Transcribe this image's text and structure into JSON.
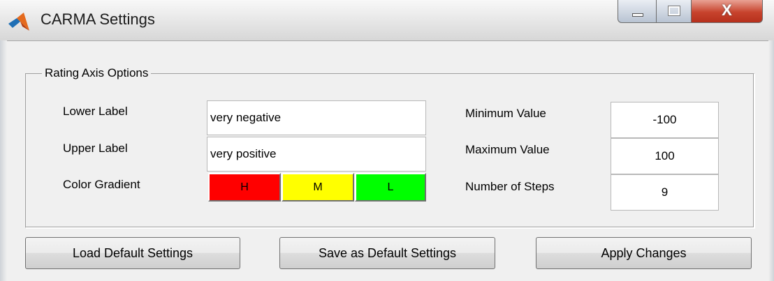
{
  "window": {
    "title": "CARMA Settings",
    "controls": {
      "minimize": "minimize",
      "maximize": "maximize",
      "close_label": "X"
    }
  },
  "group": {
    "title": "Rating Axis Options",
    "lower_label": {
      "label": "Lower Label",
      "value": "very negative"
    },
    "upper_label": {
      "label": "Upper Label",
      "value": "very positive"
    },
    "color_gradient": {
      "label": "Color Gradient",
      "swatches": [
        {
          "text": "H",
          "color": "#ff0000"
        },
        {
          "text": "M",
          "color": "#ffff00"
        },
        {
          "text": "L",
          "color": "#00ff00"
        }
      ]
    },
    "minimum_value": {
      "label": "Minimum Value",
      "value": "-100"
    },
    "maximum_value": {
      "label": "Maximum Value",
      "value": "100"
    },
    "number_of_steps": {
      "label": "Number of Steps",
      "value": "9"
    }
  },
  "buttons": {
    "load_default": "Load Default Settings",
    "save_default": "Save as Default Settings",
    "apply": "Apply Changes"
  },
  "icons": {
    "app": "matlab-logo-icon"
  }
}
